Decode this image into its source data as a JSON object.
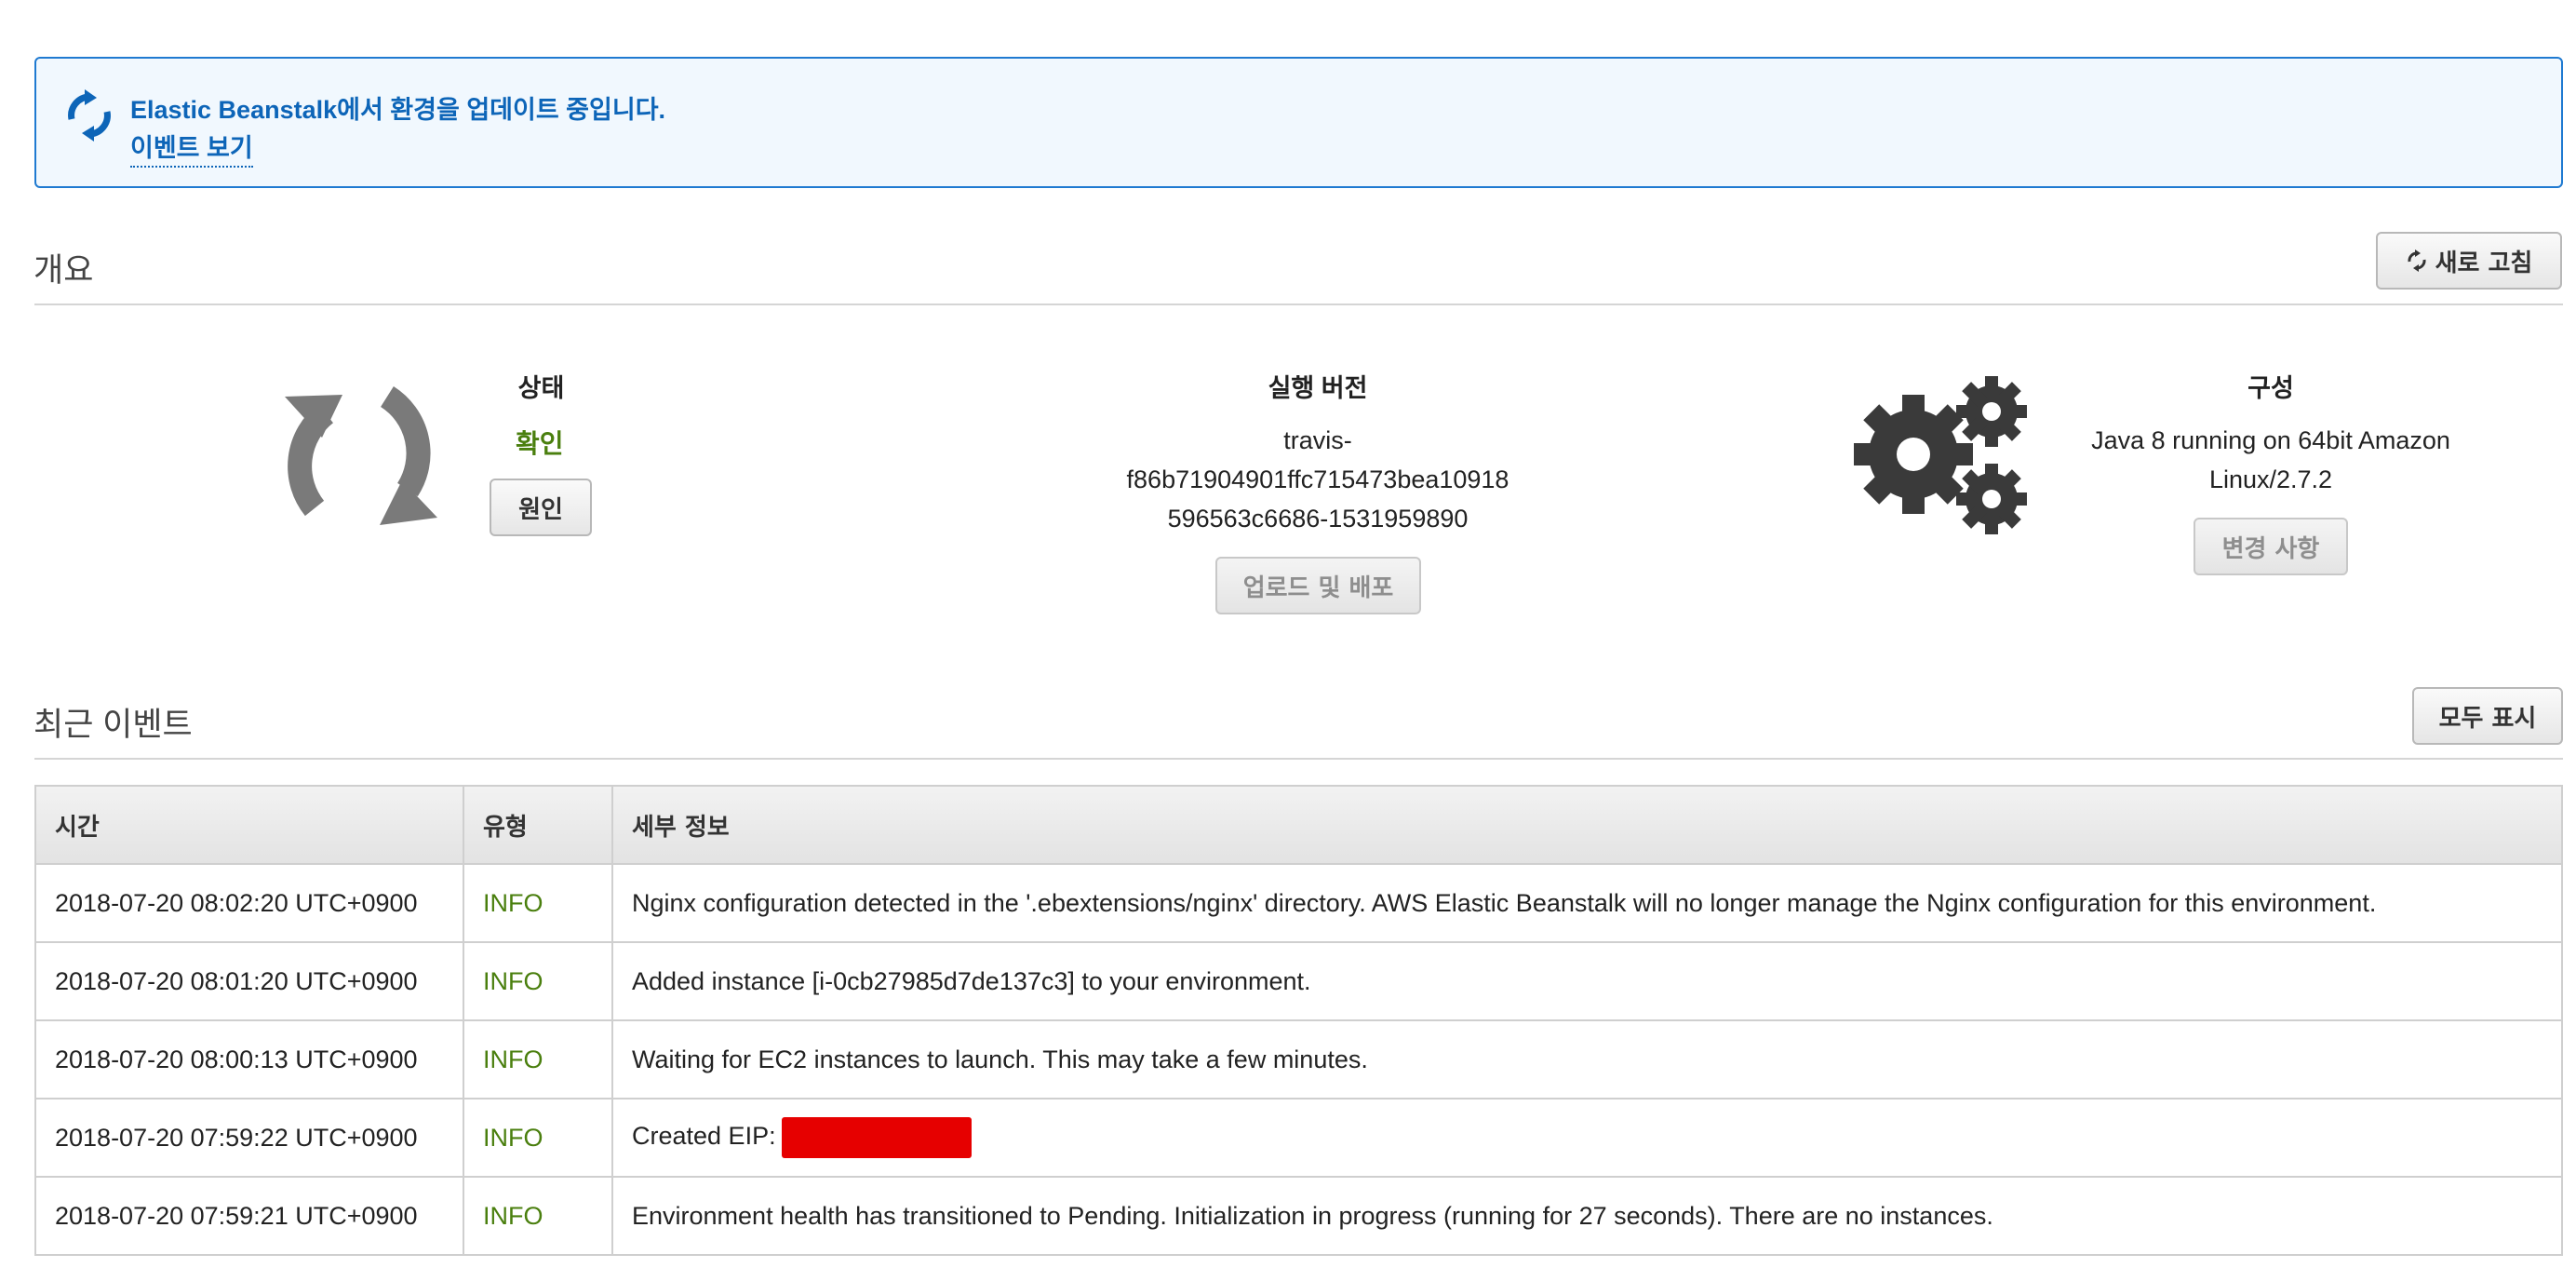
{
  "banner": {
    "message": "Elastic Beanstalk에서 환경을 업데이트 중입니다.",
    "link": "이벤트 보기",
    "icon": "refresh-icon",
    "color": "#0d65b8"
  },
  "overview": {
    "title": "개요",
    "refresh_button": "새로 고침",
    "status": {
      "label": "상태",
      "value": "확인",
      "cause_button": "원인",
      "icon": "sync-icon"
    },
    "running_version": {
      "label": "실행 버전",
      "value_lines": [
        "travis-",
        "f86b71904901ffc715473bea10918",
        "596563c6686-1531959890"
      ],
      "deploy_button": "업로드 및 배포"
    },
    "configuration": {
      "label": "구성",
      "value_lines": [
        "Java 8 running on 64bit Amazon",
        "Linux/2.7.2"
      ],
      "change_button": "변경 사항",
      "icon": "gears-icon"
    }
  },
  "events": {
    "title": "최근 이벤트",
    "show_all_button": "모두 표시",
    "columns": [
      "시간",
      "유형",
      "세부 정보"
    ],
    "rows": [
      {
        "time": "2018-07-20 08:02:20 UTC+0900",
        "type": "INFO",
        "details": "Nginx configuration detected in the '.ebextensions/nginx' directory. AWS Elastic Beanstalk will no longer manage the Nginx configuration for this environment."
      },
      {
        "time": "2018-07-20 08:01:20 UTC+0900",
        "type": "INFO",
        "details": "Added instance [i-0cb27985d7de137c3] to your environment."
      },
      {
        "time": "2018-07-20 08:00:13 UTC+0900",
        "type": "INFO",
        "details": "Waiting for EC2 instances to launch. This may take a few minutes."
      },
      {
        "time": "2018-07-20 07:59:22 UTC+0900",
        "type": "INFO",
        "details": "Created EIP:"
      },
      {
        "time": "2018-07-20 07:59:21 UTC+0900",
        "type": "INFO",
        "details": "Environment health has transitioned to Pending. Initialization in progress (running for 27 seconds). There are no instances."
      }
    ]
  },
  "colors": {
    "accent": "#0d65b8",
    "ok_green": "#4a7f0e",
    "redaction": "#e60000"
  }
}
